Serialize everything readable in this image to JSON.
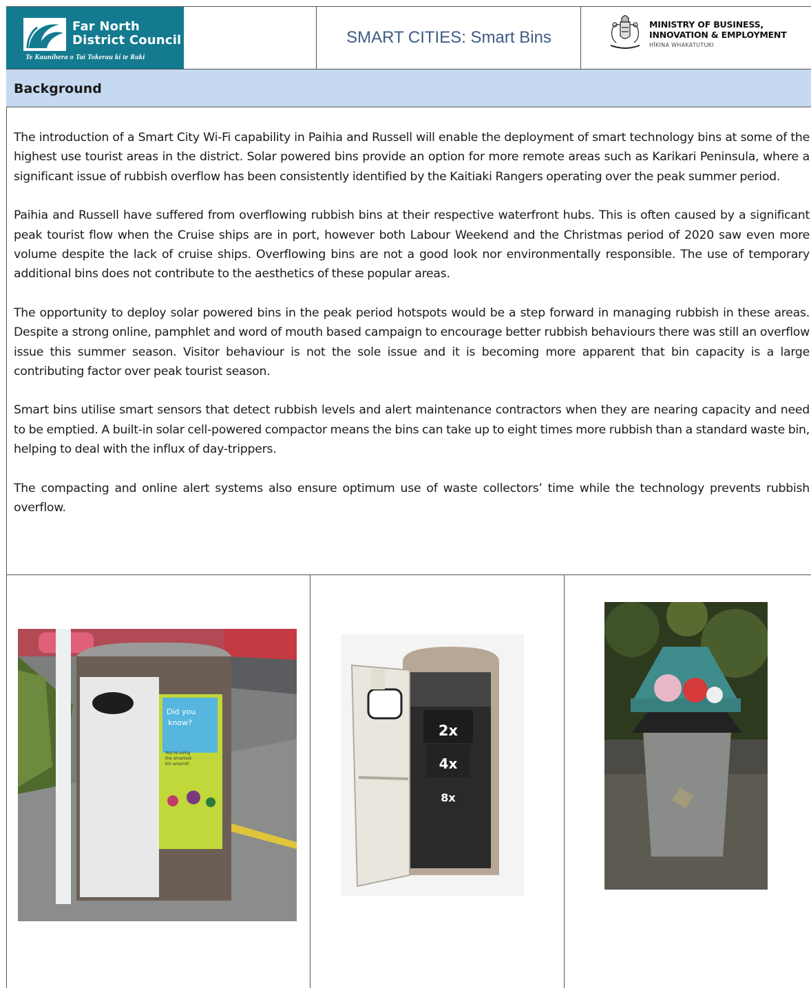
{
  "header": {
    "council_name_line1": "Far North",
    "council_name_line2": "District Council",
    "council_tagline": "Te Kaunihera o Tai Tokerau ki te Raki",
    "document_title": "SMART CITIES: Smart Bins",
    "ministry_line1": "MINISTRY OF BUSINESS,",
    "ministry_line2": "INNOVATION & EMPLOYMENT",
    "ministry_line3": "HĪKINA WHAKATUTUKI"
  },
  "section": {
    "title": "Background",
    "paragraphs": [
      "The introduction of a Smart City Wi-Fi capability in Paihia and Russell will enable the deployment of smart technology bins at some of the highest use tourist areas in the district. Solar powered bins provide an option for more remote areas such as Karikari Peninsula, where a significant issue of rubbish overflow has been consistently identified by the Kaitiaki Rangers operating over the peak summer period.",
      "Paihia and Russell have suffered from overflowing rubbish bins at their respective waterfront hubs. This is often caused by a significant peak tourist flow when the Cruise ships are in port, however both Labour Weekend and the Christmas period of 2020 saw even more volume despite the lack of cruise ships. Overflowing bins are not a good look nor environmentally responsible. The use of temporary additional bins does not contribute to the aesthetics of these popular areas.",
      "The opportunity to deploy solar powered bins in the peak period hotspots would be a step forward in managing rubbish in these areas. Despite a strong online, pamphlet and word of mouth based campaign to encourage better rubbish behaviours there was still an overflow issue this summer season. Visitor behaviour is not the sole issue and it is becoming more apparent that bin capacity is a large contributing factor over peak tourist season.",
      "Smart bins utilise smart sensors that detect rubbish levels and alert maintenance contractors when they are nearing capacity and need to be emptied. A built-in solar cell-powered compactor means the bins can take up to eight times more rubbish than a standard waste bin, helping to deal with the influx of day-trippers.",
      "The compacting and online alert systems also ensure optimum use of waste collectors’ time while the technology prevents rubbish overflow."
    ]
  },
  "photos": {
    "smart_bin_poster": {
      "line1": "Did you",
      "line2": "know?",
      "line3": "You're using",
      "line4": "the smartest",
      "line5": "bin around!"
    },
    "compactor_diagram": {
      "level1": "2x",
      "level2": "4x",
      "level3": "8x"
    }
  }
}
